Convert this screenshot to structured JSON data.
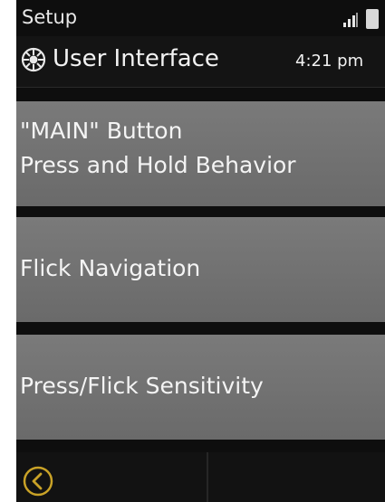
{
  "status_bar": {
    "app_title": "Setup",
    "signal_icon": "signal-strength-icon",
    "battery_icon": "battery-icon"
  },
  "header": {
    "icon": "gear-globe-icon",
    "title": "User Interface",
    "time": "4:21 pm"
  },
  "menu": {
    "items": [
      {
        "line1": "\"MAIN\" Button",
        "line2": "Press and Hold Behavior"
      },
      {
        "line1": "Flick Navigation"
      },
      {
        "line1": "Press/Flick Sensitivity"
      }
    ]
  },
  "footer": {
    "back_icon": "back-chevron-icon",
    "accent_color": "#c9a227"
  }
}
